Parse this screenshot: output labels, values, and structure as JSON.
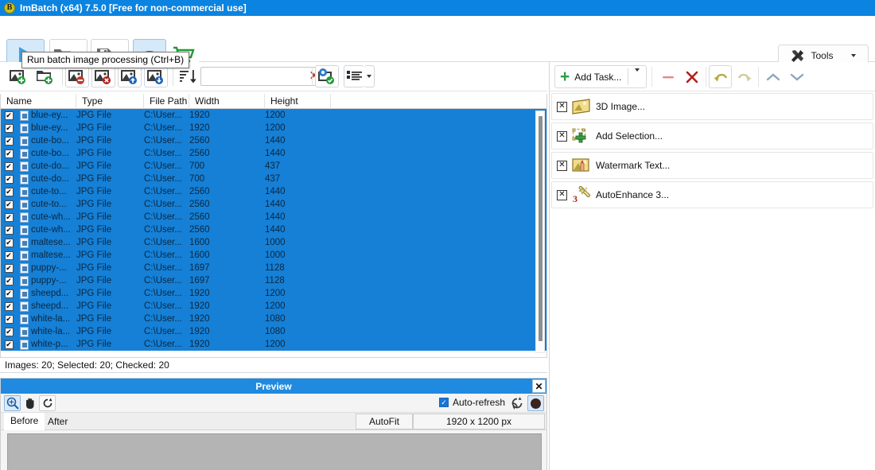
{
  "window": {
    "app_icon": "imbatch-logo-icon",
    "title": "ImBatch (x64) 7.5.0 [Free for non-commercial use]"
  },
  "tooltip": {
    "text": "Run batch image processing (Ctrl+B)"
  },
  "main_toolbar": {
    "buttons": [
      {
        "name": "run-batch-button",
        "icon": "play-icon",
        "label": ""
      },
      {
        "name": "open-button",
        "icon": "folder-open-icon",
        "label": ""
      },
      {
        "name": "open-dropdown-button",
        "icon": "chevron-down-icon",
        "label": ""
      },
      {
        "name": "save-button",
        "icon": "floppy-disk-icon",
        "label": ""
      },
      {
        "name": "save-dropdown-button",
        "icon": "chevron-down-icon",
        "label": ""
      },
      {
        "name": "preview-button",
        "icon": "eye-icon",
        "label": ""
      },
      {
        "name": "buy-button",
        "icon": "shopping-cart-icon",
        "label": ""
      }
    ],
    "tools_label": "Tools"
  },
  "list_toolbar": {
    "buttons": [
      {
        "name": "add-images-button",
        "icon": "add-image-icon"
      },
      {
        "name": "add-folder-button",
        "icon": "add-folder-icon"
      },
      {
        "name": "remove-image-button",
        "icon": "remove-image-icon"
      },
      {
        "name": "remove-all-images-button",
        "icon": "delete-image-icon"
      },
      {
        "name": "move-image-up-button",
        "icon": "image-up-icon"
      },
      {
        "name": "move-image-down-button",
        "icon": "image-down-icon"
      },
      {
        "name": "sort-button",
        "icon": "sort-descending-icon"
      },
      {
        "name": "sort-dropdown-button",
        "icon": "chevron-down-icon"
      },
      {
        "name": "check-images-button",
        "icon": "image-settings-check-icon"
      },
      {
        "name": "view-mode-button",
        "icon": "list-view-icon"
      },
      {
        "name": "view-mode-dropdown-button",
        "icon": "chevron-down-icon"
      }
    ],
    "search": {
      "value": "",
      "placeholder": "",
      "clear_icon": "clear-x-icon"
    }
  },
  "file_list": {
    "columns": [
      "Name",
      "Type",
      "File Path",
      "Width",
      "Height"
    ],
    "rows": [
      {
        "checked": true,
        "name": "blue-ey...",
        "type": "JPG File",
        "path": "C:\\User...",
        "width": "1920",
        "height": "1200"
      },
      {
        "checked": true,
        "name": "blue-ey...",
        "type": "JPG File",
        "path": "C:\\User...",
        "width": "1920",
        "height": "1200"
      },
      {
        "checked": true,
        "name": "cute-bo...",
        "type": "JPG File",
        "path": "C:\\User...",
        "width": "2560",
        "height": "1440"
      },
      {
        "checked": true,
        "name": "cute-bo...",
        "type": "JPG File",
        "path": "C:\\User...",
        "width": "2560",
        "height": "1440"
      },
      {
        "checked": true,
        "name": "cute-do...",
        "type": "JPG File",
        "path": "C:\\User...",
        "width": "700",
        "height": "437"
      },
      {
        "checked": true,
        "name": "cute-do...",
        "type": "JPG File",
        "path": "C:\\User...",
        "width": "700",
        "height": "437"
      },
      {
        "checked": true,
        "name": "cute-to...",
        "type": "JPG File",
        "path": "C:\\User...",
        "width": "2560",
        "height": "1440"
      },
      {
        "checked": true,
        "name": "cute-to...",
        "type": "JPG File",
        "path": "C:\\User...",
        "width": "2560",
        "height": "1440"
      },
      {
        "checked": true,
        "name": "cute-wh...",
        "type": "JPG File",
        "path": "C:\\User...",
        "width": "2560",
        "height": "1440"
      },
      {
        "checked": true,
        "name": "cute-wh...",
        "type": "JPG File",
        "path": "C:\\User...",
        "width": "2560",
        "height": "1440"
      },
      {
        "checked": true,
        "name": "maltese...",
        "type": "JPG File",
        "path": "C:\\User...",
        "width": "1600",
        "height": "1000"
      },
      {
        "checked": true,
        "name": "maltese...",
        "type": "JPG File",
        "path": "C:\\User...",
        "width": "1600",
        "height": "1000"
      },
      {
        "checked": true,
        "name": "puppy-...",
        "type": "JPG File",
        "path": "C:\\User...",
        "width": "1697",
        "height": "1128"
      },
      {
        "checked": true,
        "name": "puppy-...",
        "type": "JPG File",
        "path": "C:\\User...",
        "width": "1697",
        "height": "1128"
      },
      {
        "checked": true,
        "name": "sheepd...",
        "type": "JPG File",
        "path": "C:\\User...",
        "width": "1920",
        "height": "1200"
      },
      {
        "checked": true,
        "name": "sheepd...",
        "type": "JPG File",
        "path": "C:\\User...",
        "width": "1920",
        "height": "1200"
      },
      {
        "checked": true,
        "name": "white-la...",
        "type": "JPG File",
        "path": "C:\\User...",
        "width": "1920",
        "height": "1080"
      },
      {
        "checked": true,
        "name": "white-la...",
        "type": "JPG File",
        "path": "C:\\User...",
        "width": "1920",
        "height": "1080"
      },
      {
        "checked": true,
        "name": "white-p...",
        "type": "JPG File",
        "path": "C:\\User...",
        "width": "1920",
        "height": "1200"
      }
    ],
    "checkmark": "✔",
    "status": "Images: 20; Selected: 20; Checked: 20",
    "selection_color": "#1580d6"
  },
  "preview": {
    "title": "Preview",
    "close_label": "✕",
    "tools": [
      {
        "name": "zoom-tool-button",
        "icon": "magnifier-icon",
        "active": true
      },
      {
        "name": "pan-tool-button",
        "icon": "hand-icon",
        "active": false
      },
      {
        "name": "rotate-tool-button",
        "icon": "rotate-icon",
        "active": false
      }
    ],
    "auto_refresh_label": "Auto-refresh",
    "auto_refresh_checked": true,
    "refresh_icon": "refresh-circle-icon",
    "stop_icon": "stop-circle-icon",
    "tabs": [
      {
        "label": "Before",
        "selected": true
      },
      {
        "label": "After",
        "selected": false
      }
    ],
    "autofit_label": "AutoFit",
    "dimensions_label": "1920 x 1200 px"
  },
  "task_panel": {
    "add_task_label": "Add Task...",
    "buttons": [
      {
        "name": "remove-task-button",
        "icon": "minus-icon"
      },
      {
        "name": "delete-all-tasks-button",
        "icon": "x-icon"
      },
      {
        "name": "undo-button",
        "icon": "undo-arrow-icon"
      },
      {
        "name": "redo-button",
        "icon": "redo-arrow-icon"
      },
      {
        "name": "move-task-up-button",
        "icon": "chevron-up-icon"
      },
      {
        "name": "move-task-down-button",
        "icon": "chevron-down-icon"
      }
    ],
    "tasks": [
      {
        "label": "3D Image...",
        "icon": "3d-image-icon",
        "enabled": false
      },
      {
        "label": "Add Selection...",
        "icon": "add-selection-icon",
        "enabled": false
      },
      {
        "label": "Watermark Text...",
        "icon": "watermark-text-icon",
        "enabled": false
      },
      {
        "label": "AutoEnhance 3...",
        "icon": "auto-enhance-icon",
        "enabled": false
      }
    ],
    "disabled_mark": "✕"
  },
  "colors": {
    "title_blue": "#0b83e0",
    "selection_blue": "#1580d6",
    "preview_header_blue": "#1f8ae0",
    "accent_green": "#2e9e44",
    "accent_red": "#c0392b"
  }
}
